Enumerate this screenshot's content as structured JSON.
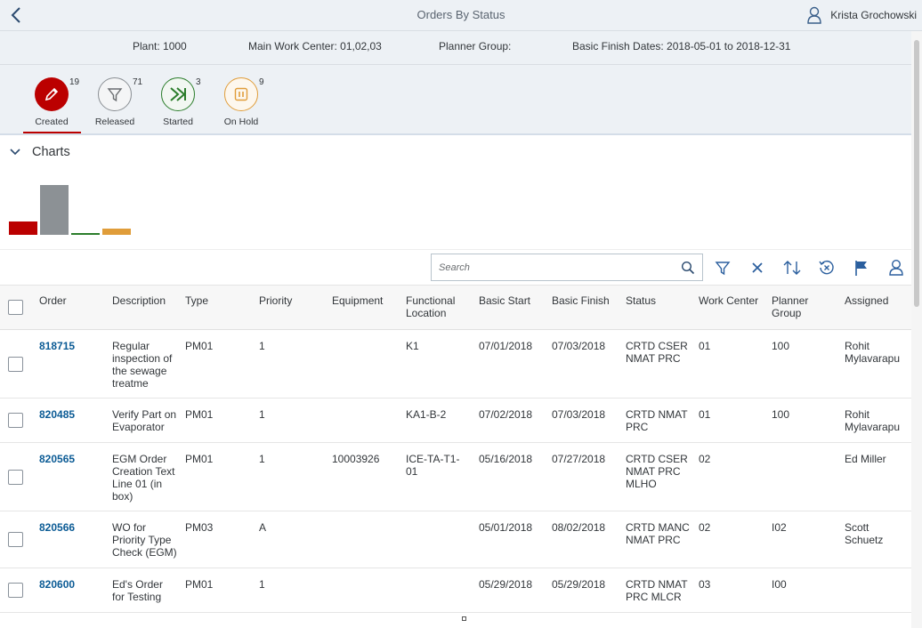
{
  "shell": {
    "title": "Orders By Status",
    "user_name": "Krista Grochowski"
  },
  "filters": {
    "plant": "Plant: 1000",
    "work_center": "Main Work Center: 01,02,03",
    "planner_group": "Planner Group:",
    "finish_dates": "Basic Finish Dates: 2018-05-01 to 2018-12-31"
  },
  "status_tabs": [
    {
      "label": "Created",
      "count": "19",
      "icon": "pencil-icon",
      "color": "#bb0000",
      "selected": true
    },
    {
      "label": "Released",
      "count": "71",
      "icon": "filter-icon",
      "color": "#8a8f94",
      "selected": false
    },
    {
      "label": "Started",
      "count": "3",
      "icon": "fast-forward-icon",
      "color": "#2b7d2b",
      "selected": false
    },
    {
      "label": "On Hold",
      "count": "9",
      "icon": "pause-icon",
      "color": "#e09d3a",
      "selected": false
    }
  ],
  "charts": {
    "title": "Charts",
    "chart_data": {
      "type": "bar",
      "categories": [
        "Created",
        "Released",
        "Started",
        "On Hold"
      ],
      "values": [
        19,
        71,
        3,
        9
      ],
      "colors": [
        "#bb0000",
        "#8c9195",
        "#2b7d2b",
        "#e09d3a"
      ]
    }
  },
  "search": {
    "placeholder": "Search"
  },
  "table": {
    "headers": {
      "order": "Order",
      "description": "Description",
      "type": "Type",
      "priority": "Priority",
      "equipment": "Equipment",
      "functional_location": "Functional\nLocation",
      "basic_start": "Basic Start",
      "basic_finish": "Basic Finish",
      "status": "Status",
      "work_center": "Work Center",
      "planner_group": "Planner\nGroup",
      "assigned": "Assigned"
    },
    "rows": [
      {
        "order": "818715",
        "description": "Regular\ninspection of\nthe sewage\ntreatme",
        "type": "PM01",
        "priority": "1",
        "equipment": "",
        "functional_location": "K1",
        "basic_start": "07/01/2018",
        "basic_finish": "07/03/2018",
        "status": "CRTD CSER\nNMAT PRC",
        "work_center": "01",
        "planner_group": "100",
        "assigned": "Rohit\nMylavarapu"
      },
      {
        "order": "820485",
        "description": "Verify Part on\nEvaporator",
        "type": "PM01",
        "priority": "1",
        "equipment": "",
        "functional_location": "KA1-B-2",
        "basic_start": "07/02/2018",
        "basic_finish": "07/03/2018",
        "status": "CRTD NMAT\nPRC",
        "work_center": "01",
        "planner_group": "100",
        "assigned": "Rohit\nMylavarapu"
      },
      {
        "order": "820565",
        "description": "EGM Order\nCreation Text\nLine 01 (in\nbox)",
        "type": "PM01",
        "priority": "1",
        "equipment": "10003926",
        "functional_location": "ICE-TA-T1-\n01",
        "basic_start": "05/16/2018",
        "basic_finish": "07/27/2018",
        "status": "CRTD CSER\nNMAT PRC\nMLHO",
        "work_center": "02",
        "planner_group": "",
        "assigned": "Ed Miller"
      },
      {
        "order": "820566",
        "description": "WO for\nPriority Type\nCheck (EGM)",
        "type": "PM03",
        "priority": "A",
        "equipment": "",
        "functional_location": "",
        "basic_start": "05/01/2018",
        "basic_finish": "08/02/2018",
        "status": "CRTD MANC\nNMAT PRC",
        "work_center": "02",
        "planner_group": "I02",
        "assigned": "Scott\nSchuetz"
      },
      {
        "order": "820600",
        "description": "Ed's Order\nfor Testing",
        "type": "PM01",
        "priority": "1",
        "equipment": "",
        "functional_location": "",
        "basic_start": "05/29/2018",
        "basic_finish": "05/29/2018",
        "status": "CRTD NMAT\nPRC MLCR",
        "work_center": "03",
        "planner_group": "I00",
        "assigned": ""
      }
    ]
  }
}
